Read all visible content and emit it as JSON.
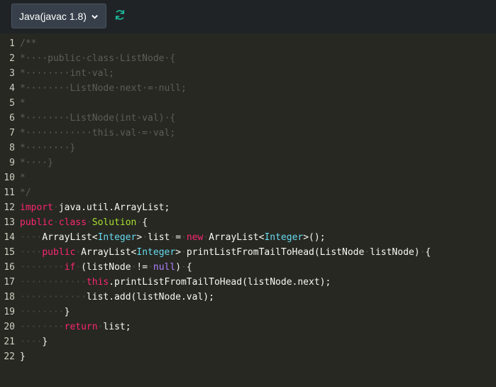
{
  "toolbar": {
    "language_label": "Java(javac 1.8)",
    "dropdown_icon": "chevron-down-icon",
    "reset_icon": "refresh-icon",
    "accent_color": "#1abc9c"
  },
  "editor": {
    "theme_colors": {
      "background": "#272822",
      "comment": "#5e5d57",
      "keyword": "#f92672",
      "type": "#66d9ef",
      "class_name": "#a6e22e",
      "literal": "#ae81ff",
      "text": "#f8f8f2"
    },
    "lines": [
      {
        "num": "1",
        "tokens": [
          {
            "t": "/**",
            "c": "comment"
          }
        ]
      },
      {
        "num": "2",
        "tokens": [
          {
            "t": "*····public·class·ListNode·{",
            "c": "comment"
          }
        ]
      },
      {
        "num": "3",
        "tokens": [
          {
            "t": "*········int·val;",
            "c": "comment"
          }
        ]
      },
      {
        "num": "4",
        "tokens": [
          {
            "t": "*········ListNode·next·=·null;",
            "c": "comment"
          }
        ]
      },
      {
        "num": "5",
        "tokens": [
          {
            "t": "*",
            "c": "comment"
          }
        ]
      },
      {
        "num": "6",
        "tokens": [
          {
            "t": "*········ListNode(int·val)·{",
            "c": "comment"
          }
        ]
      },
      {
        "num": "7",
        "tokens": [
          {
            "t": "*············this.val·=·val;",
            "c": "comment"
          }
        ]
      },
      {
        "num": "8",
        "tokens": [
          {
            "t": "*········}",
            "c": "comment"
          }
        ]
      },
      {
        "num": "9",
        "tokens": [
          {
            "t": "*····}",
            "c": "comment"
          }
        ]
      },
      {
        "num": "10",
        "tokens": [
          {
            "t": "*",
            "c": "comment"
          }
        ]
      },
      {
        "num": "11",
        "tokens": [
          {
            "t": "*/",
            "c": "comment"
          }
        ]
      },
      {
        "num": "12",
        "tokens": [
          {
            "t": "import",
            "c": "kw"
          },
          {
            "t": "·",
            "c": "ws"
          },
          {
            "t": "java.util.ArrayList;",
            "c": ""
          }
        ]
      },
      {
        "num": "13",
        "tokens": [
          {
            "t": "public",
            "c": "kw"
          },
          {
            "t": "·",
            "c": "ws"
          },
          {
            "t": "class",
            "c": "kw"
          },
          {
            "t": "·",
            "c": "ws"
          },
          {
            "t": "Solution",
            "c": "cls"
          },
          {
            "t": "·",
            "c": "ws"
          },
          {
            "t": "{",
            "c": ""
          }
        ]
      },
      {
        "num": "14",
        "tokens": [
          {
            "t": "····",
            "c": "ws"
          },
          {
            "t": "ArrayList<",
            "c": ""
          },
          {
            "t": "Integer",
            "c": "type"
          },
          {
            "t": ">",
            "c": ""
          },
          {
            "t": "·",
            "c": "ws"
          },
          {
            "t": "list",
            "c": ""
          },
          {
            "t": "·",
            "c": "ws"
          },
          {
            "t": "=",
            "c": ""
          },
          {
            "t": "·",
            "c": "ws"
          },
          {
            "t": "new",
            "c": "kw"
          },
          {
            "t": "·",
            "c": "ws"
          },
          {
            "t": "ArrayList<",
            "c": ""
          },
          {
            "t": "Integer",
            "c": "type"
          },
          {
            "t": ">();",
            "c": ""
          }
        ]
      },
      {
        "num": "15",
        "tokens": [
          {
            "t": "····",
            "c": "ws"
          },
          {
            "t": "public",
            "c": "kw"
          },
          {
            "t": "·",
            "c": "ws"
          },
          {
            "t": "ArrayList<",
            "c": ""
          },
          {
            "t": "Integer",
            "c": "type"
          },
          {
            "t": ">",
            "c": ""
          },
          {
            "t": "·",
            "c": "ws"
          },
          {
            "t": "printListFromTailToHead(ListNode",
            "c": ""
          },
          {
            "t": "·",
            "c": "ws"
          },
          {
            "t": "listNode)",
            "c": ""
          },
          {
            "t": "·",
            "c": "ws"
          },
          {
            "t": "{",
            "c": ""
          }
        ]
      },
      {
        "num": "16",
        "tokens": [
          {
            "t": "········",
            "c": "ws"
          },
          {
            "t": "if",
            "c": "kw"
          },
          {
            "t": "·",
            "c": "ws"
          },
          {
            "t": "(listNode",
            "c": ""
          },
          {
            "t": "·",
            "c": "ws"
          },
          {
            "t": "!=",
            "c": ""
          },
          {
            "t": "·",
            "c": "ws"
          },
          {
            "t": "null",
            "c": "lit"
          },
          {
            "t": ")",
            "c": ""
          },
          {
            "t": "·",
            "c": "ws"
          },
          {
            "t": "{",
            "c": ""
          }
        ]
      },
      {
        "num": "17",
        "tokens": [
          {
            "t": "············",
            "c": "ws"
          },
          {
            "t": "this",
            "c": "kw"
          },
          {
            "t": ".printListFromTailToHead(listNode.next);",
            "c": ""
          }
        ]
      },
      {
        "num": "18",
        "tokens": [
          {
            "t": "············",
            "c": "ws"
          },
          {
            "t": "list.add(listNode.val);",
            "c": ""
          }
        ]
      },
      {
        "num": "19",
        "tokens": [
          {
            "t": "········",
            "c": "ws"
          },
          {
            "t": "}",
            "c": ""
          }
        ]
      },
      {
        "num": "20",
        "tokens": [
          {
            "t": "········",
            "c": "ws"
          },
          {
            "t": "return",
            "c": "kw"
          },
          {
            "t": "·",
            "c": "ws"
          },
          {
            "t": "list;",
            "c": ""
          }
        ]
      },
      {
        "num": "21",
        "tokens": [
          {
            "t": "····",
            "c": "ws"
          },
          {
            "t": "}",
            "c": ""
          }
        ]
      },
      {
        "num": "22",
        "tokens": [
          {
            "t": "}",
            "c": ""
          }
        ]
      }
    ]
  }
}
